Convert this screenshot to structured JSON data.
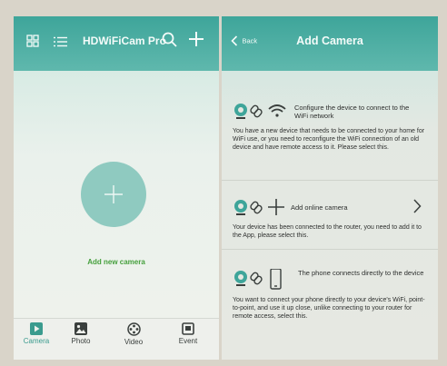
{
  "left_screen": {
    "header": {
      "title": "HDWiFiCam Pro",
      "icons": [
        "grid-icon",
        "list-icon",
        "search-icon",
        "plus-icon"
      ]
    },
    "add_camera": {
      "label": "Add new camera",
      "icon": "plus-icon"
    },
    "tabs": [
      {
        "label": "Camera",
        "icon": "camera-play-icon",
        "active": true
      },
      {
        "label": "Photo",
        "icon": "photo-icon",
        "active": false
      },
      {
        "label": "Video",
        "icon": "video-reel-icon",
        "active": false
      },
      {
        "label": "Event",
        "icon": "event-icon",
        "active": false
      }
    ]
  },
  "right_screen": {
    "header": {
      "back_label": "Back",
      "title": "Add Camera"
    },
    "options": [
      {
        "icons": [
          "camera-icon",
          "link-icon",
          "wifi-icon"
        ],
        "title": "Configure the device to connect to the WiFi network",
        "description": "You have a new device that needs to be connected to your home for WiFi use, or you need to reconfigure the WiFi connection of an old device and have remote access to it. Please select this."
      },
      {
        "icons": [
          "camera-icon",
          "link-icon",
          "plus-icon"
        ],
        "title": "Add online camera",
        "chevron": "chevron-right-icon",
        "description": "Your device has been connected to the router, you need to add it to the App, please select this."
      },
      {
        "icons": [
          "camera-icon",
          "link-icon",
          "phone-icon"
        ],
        "title": "The phone connects directly to the device",
        "description": "You want to connect your phone directly to your device's WiFi, point-to-point, and use it up close, unlike connecting to your router for remote access, select this."
      }
    ]
  },
  "colors": {
    "header_teal": "#3ea59a",
    "add_circle": "#8fcac0",
    "add_label_green": "#46a03d",
    "active_tab": "#3a9b8e"
  }
}
